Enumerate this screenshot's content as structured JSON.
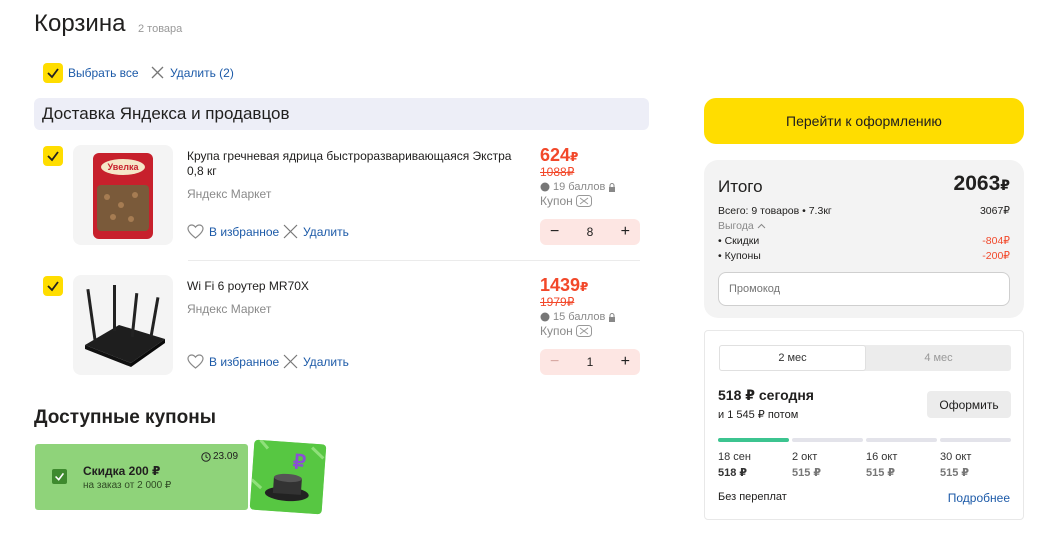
{
  "header": {
    "title": "Корзина",
    "count": "2 товара"
  },
  "toolbar": {
    "select_all": "Выбрать все",
    "delete": "Удалить (2)"
  },
  "group": {
    "title": "Доставка Яндекса и продавцов"
  },
  "items": [
    {
      "name": "Крупа гречневая ядрица быстроразваривающаяся Экстра 0,8 кг",
      "seller": "Яндекс Маркет",
      "price": "624",
      "old_price": "1088",
      "points": "19 баллов",
      "coupon": "Купон",
      "qty": "8",
      "fav": "В избранное",
      "remove": "Удалить"
    },
    {
      "name": "Wi Fi 6 роутер MR70X",
      "seller": "Яндекс Маркет",
      "price": "1439",
      "old_price": "1979",
      "points": "15 баллов",
      "coupon": "Купон",
      "qty": "1",
      "fav": "В избранное",
      "remove": "Удалить"
    }
  ],
  "currency": "₽",
  "coupons": {
    "title": "Доступные купоны",
    "item": {
      "name": "Скидка 200 ₽",
      "condition": "на заказ от 2 000 ₽",
      "date": "23.09"
    }
  },
  "checkout": {
    "button": "Перейти к оформлению"
  },
  "summary": {
    "title": "Итого",
    "total": "2063",
    "goods_label": "Всего: 9 товаров • 7.3кг",
    "goods_value": "3067₽",
    "benefit_label": "Выгода",
    "discounts_label": "• Скидки",
    "discounts_value": "-804₽",
    "coupons_label": "• Купоны",
    "coupons_value": "-200₽",
    "promo_placeholder": "Промокод"
  },
  "split": {
    "tabs": [
      "2 мес",
      "4 мес"
    ],
    "today": "518 ₽ сегодня",
    "later": "и 1 545 ₽ потом",
    "button": "Оформить",
    "schedule": [
      {
        "date": "18 сен",
        "amount": "518 ₽"
      },
      {
        "date": "2 окт",
        "amount": "515 ₽"
      },
      {
        "date": "16 окт",
        "amount": "515 ₽"
      },
      {
        "date": "30 окт",
        "amount": "515 ₽"
      }
    ],
    "no_overpay": "Без переплат",
    "more": "Подробнее"
  },
  "colors": {
    "accent": "#ffdd00",
    "price": "#f2482a",
    "link": "#1c5aa8",
    "progress": "#3cc490",
    "coupon": "#8fd37a"
  }
}
